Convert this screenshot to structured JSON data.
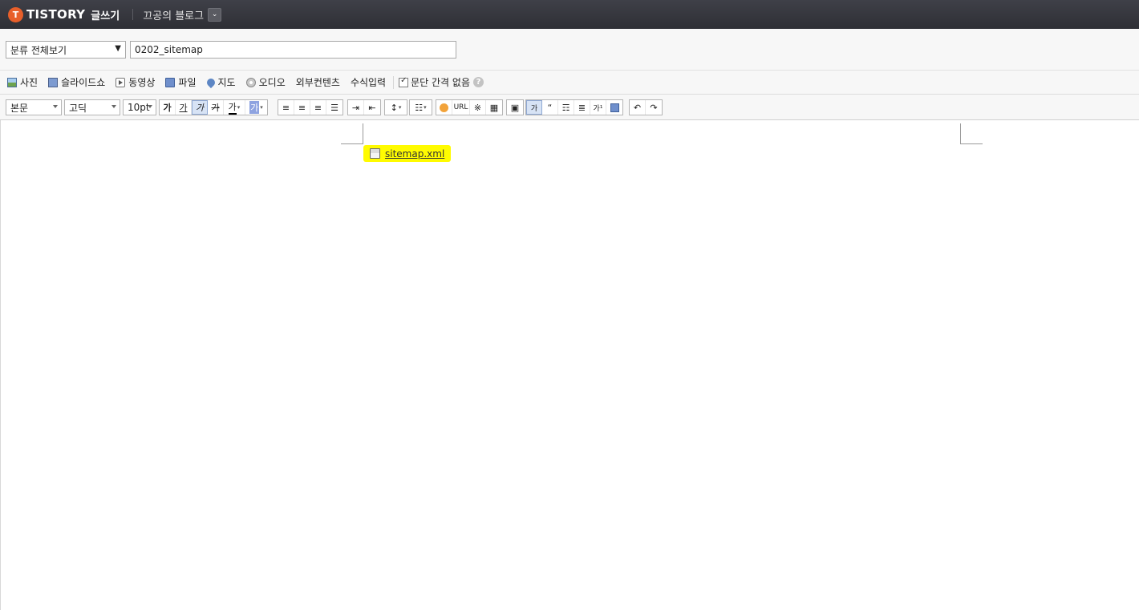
{
  "header": {
    "logo_icon": "T",
    "logo_text": "TISTORY",
    "write_label": "글쓰기",
    "blog_name": "끄공의 블로그",
    "blog_dropdown_icon": "chevron-down-icon"
  },
  "post": {
    "category_value": "분류 전체보기",
    "category_arrow": "▼",
    "title_value": "0202_sitemap"
  },
  "attach": {
    "photo": "사진",
    "slideshow": "슬라이드쇼",
    "video": "동영상",
    "file": "파일",
    "map": "지도",
    "audio": "오디오",
    "external": "외부컨텐츠",
    "formula": "수식입력",
    "no_paragraph_spacing": "문단 간격 없음",
    "help": "?"
  },
  "format": {
    "paragraph_style": "본문",
    "font_family": "고딕",
    "font_size": "10pt",
    "bold": "가",
    "underline": "가",
    "italic": "가",
    "strike": "가",
    "text_color": "가",
    "bg_color": "가",
    "url": "URL",
    "special_char": "※",
    "quote": "“",
    "sup": "가¹",
    "undo": "↶",
    "redo": "↷"
  },
  "content": {
    "attached_file_name": "sitemap.xml",
    "highlight_color": "#fffb00"
  }
}
